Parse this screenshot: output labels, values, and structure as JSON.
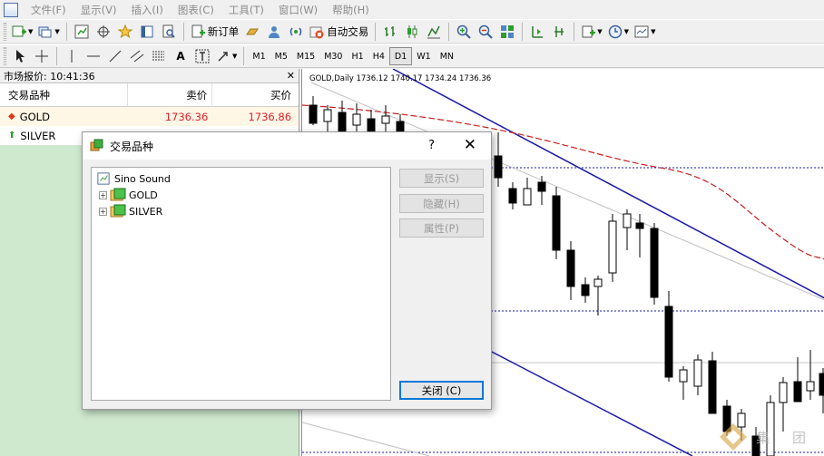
{
  "menubar": {
    "items": [
      "文件(F)",
      "显示(V)",
      "插入(I)",
      "图表(C)",
      "工具(T)",
      "窗口(W)",
      "帮助(H)"
    ]
  },
  "toolbar": {
    "new_order": "新订单",
    "auto_trading": "自动交易",
    "timeframes": [
      "M1",
      "M5",
      "M15",
      "M30",
      "H1",
      "H4",
      "D1",
      "W1",
      "MN"
    ],
    "active_timeframe": "D1"
  },
  "market_watch": {
    "title": "市场报价: 10:41:36",
    "columns": [
      "交易品种",
      "卖价",
      "买价"
    ],
    "rows": [
      {
        "symbol": "GOLD",
        "bid": "1736.36",
        "ask": "1736.86",
        "direction": "down"
      },
      {
        "symbol": "SILVER",
        "bid": "",
        "ask": "",
        "direction": "up"
      }
    ]
  },
  "chart": {
    "label": "GOLD,Daily  1736.12 1740.17 1734.24 1736.36",
    "watermark": "集 团"
  },
  "dialog": {
    "title": "交易品种",
    "help": "?",
    "close_x": "✕",
    "tree": {
      "root": "Sino Sound",
      "children": [
        "GOLD",
        "SILVER"
      ]
    },
    "buttons": {
      "show": "显示(S)",
      "hide": "隐藏(H)",
      "properties": "属性(P)",
      "close": "关闭 (C)"
    }
  },
  "colors": {
    "accent": "#0078d7",
    "market_bg": "#cfe9cf",
    "trend_line": "#1a1aa8",
    "ma_line": "#c81e1e",
    "price_red": "#e0202a"
  }
}
